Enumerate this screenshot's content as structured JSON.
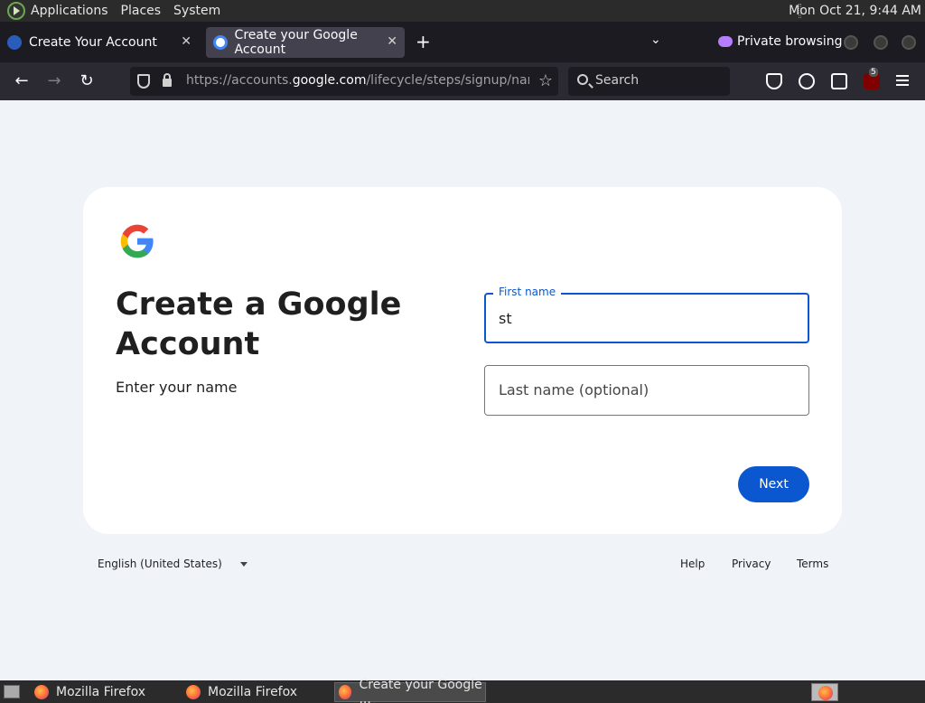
{
  "top_panel": {
    "menus": [
      "Applications",
      "Places",
      "System"
    ],
    "clock": "Mon Oct 21,  9:44 AM"
  },
  "tabs": [
    {
      "label": "Create Your Account",
      "icon": "steam-icon",
      "active": false
    },
    {
      "label": "Create your Google Account",
      "icon": "google-icon",
      "active": true
    }
  ],
  "tabstrip": {
    "private_label": "Private browsing"
  },
  "navbar": {
    "url_prefix": "https://accounts.",
    "url_domain": "google.com",
    "url_path": "/lifecycle/steps/signup/name?cc",
    "search_placeholder": "Search",
    "ublock_badge": "5"
  },
  "page": {
    "heading": "Create a Google Account",
    "subtitle": "Enter your name",
    "first_name": {
      "label": "First name",
      "value": "st"
    },
    "last_name": {
      "placeholder": "Last name (optional)"
    },
    "next_label": "Next",
    "footer": {
      "language": "English (United States)",
      "links": [
        "Help",
        "Privacy",
        "Terms"
      ]
    }
  },
  "taskbar": {
    "tasks": [
      {
        "label": "Mozilla Firefox",
        "active": false
      },
      {
        "label": "Mozilla Firefox",
        "active": false
      },
      {
        "label": "Create your Google ...",
        "active": true
      }
    ]
  },
  "colors": {
    "accent_blue": "#0b57d0",
    "page_bg": "#f0f4f9",
    "tab_active_bg": "#42414d"
  }
}
